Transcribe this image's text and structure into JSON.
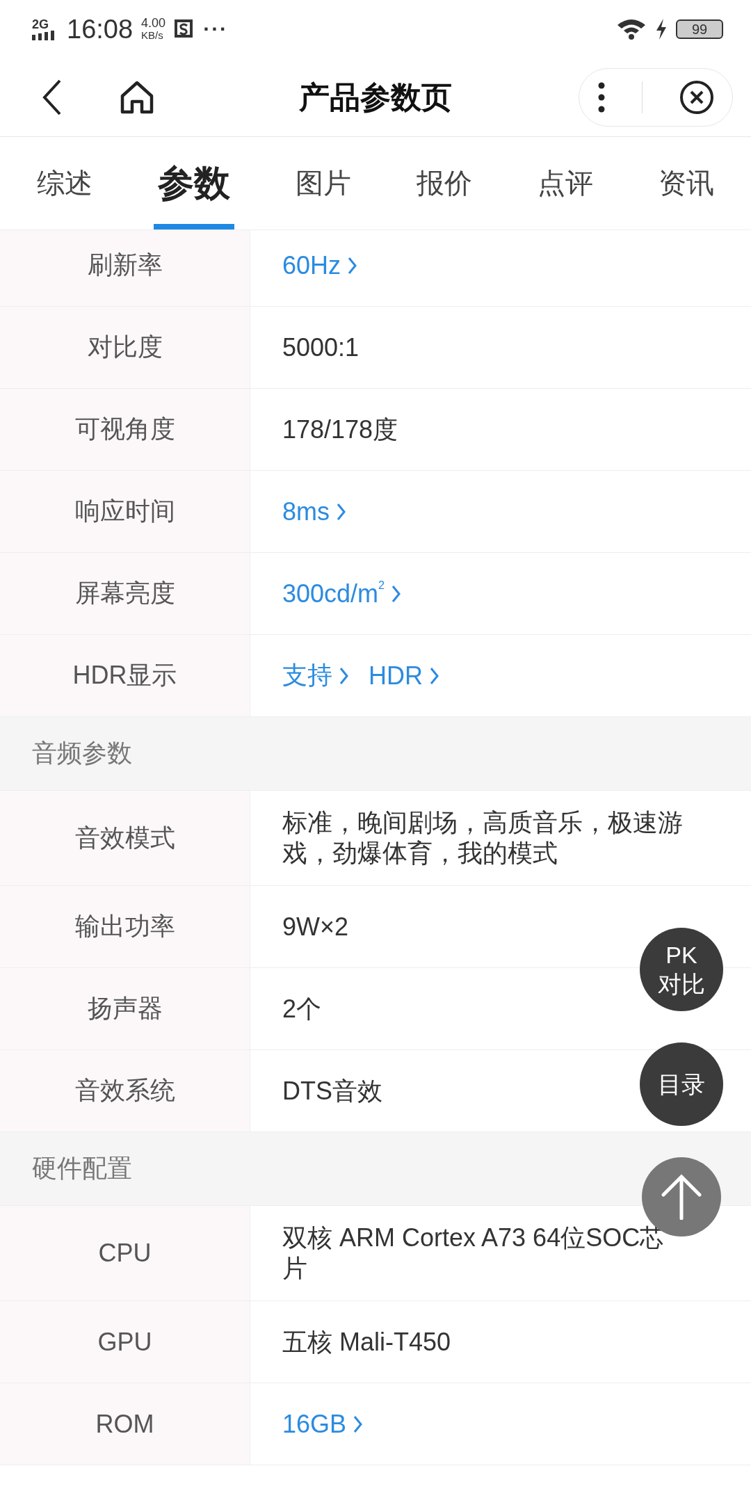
{
  "status_bar": {
    "network": "2G",
    "time": "16:08",
    "speed_value": "4.00",
    "speed_unit": "KB/s",
    "more": "···",
    "battery": "99"
  },
  "header": {
    "title": "产品参数页"
  },
  "tabs": [
    {
      "label": "综述",
      "selected": false
    },
    {
      "label": "参数",
      "selected": true
    },
    {
      "label": "图片",
      "selected": false
    },
    {
      "label": "报价",
      "selected": false
    },
    {
      "label": "点评",
      "selected": false
    },
    {
      "label": "资讯",
      "selected": false
    }
  ],
  "rows": [
    {
      "kind": "param",
      "label": "刷新率",
      "values": [
        {
          "text": "60Hz",
          "link": true
        }
      ]
    },
    {
      "kind": "param",
      "label": "对比度",
      "values": [
        {
          "text": "5000:1",
          "link": false
        }
      ]
    },
    {
      "kind": "param",
      "label": "可视角度",
      "values": [
        {
          "text": "178/178度",
          "link": false
        }
      ]
    },
    {
      "kind": "param",
      "label": "响应时间",
      "values": [
        {
          "text": "8ms",
          "link": true
        }
      ]
    },
    {
      "kind": "param",
      "label": "屏幕亮度",
      "values": [
        {
          "text": "300cd/m$^{2}$",
          "link": true
        }
      ]
    },
    {
      "kind": "param",
      "label": "HDR显示",
      "values": [
        {
          "text": "支持",
          "link": true
        },
        {
          "text": "HDR",
          "link": true
        }
      ]
    },
    {
      "kind": "section",
      "label": "音频参数"
    },
    {
      "kind": "param",
      "label": "音效模式",
      "values": [
        {
          "text": "标准，晚间剧场，高质音乐，极速游戏，劲爆体育，我的模式",
          "link": false
        }
      ]
    },
    {
      "kind": "param",
      "label": "输出功率",
      "values": [
        {
          "text": "9W×2",
          "link": false
        }
      ]
    },
    {
      "kind": "param",
      "label": "扬声器",
      "values": [
        {
          "text": "2个",
          "link": false
        }
      ]
    },
    {
      "kind": "param",
      "label": "音效系统",
      "values": [
        {
          "text": "DTS音效",
          "link": false
        }
      ]
    },
    {
      "kind": "section",
      "label": "硬件配置"
    },
    {
      "kind": "param",
      "label": "CPU",
      "values": [
        {
          "text": "双核 ARM Cortex A73 64位SOC芯片",
          "link": false
        }
      ]
    },
    {
      "kind": "param",
      "label": "GPU",
      "values": [
        {
          "text": "五核 Mali-T450",
          "link": false
        }
      ]
    },
    {
      "kind": "param",
      "label": "ROM",
      "values": [
        {
          "text": "16GB",
          "link": true
        }
      ]
    }
  ],
  "floating_buttons": [
    {
      "kind": "text",
      "lines": [
        "PK",
        "对比"
      ]
    },
    {
      "kind": "text",
      "lines": [
        "目录"
      ]
    },
    {
      "kind": "top"
    }
  ]
}
